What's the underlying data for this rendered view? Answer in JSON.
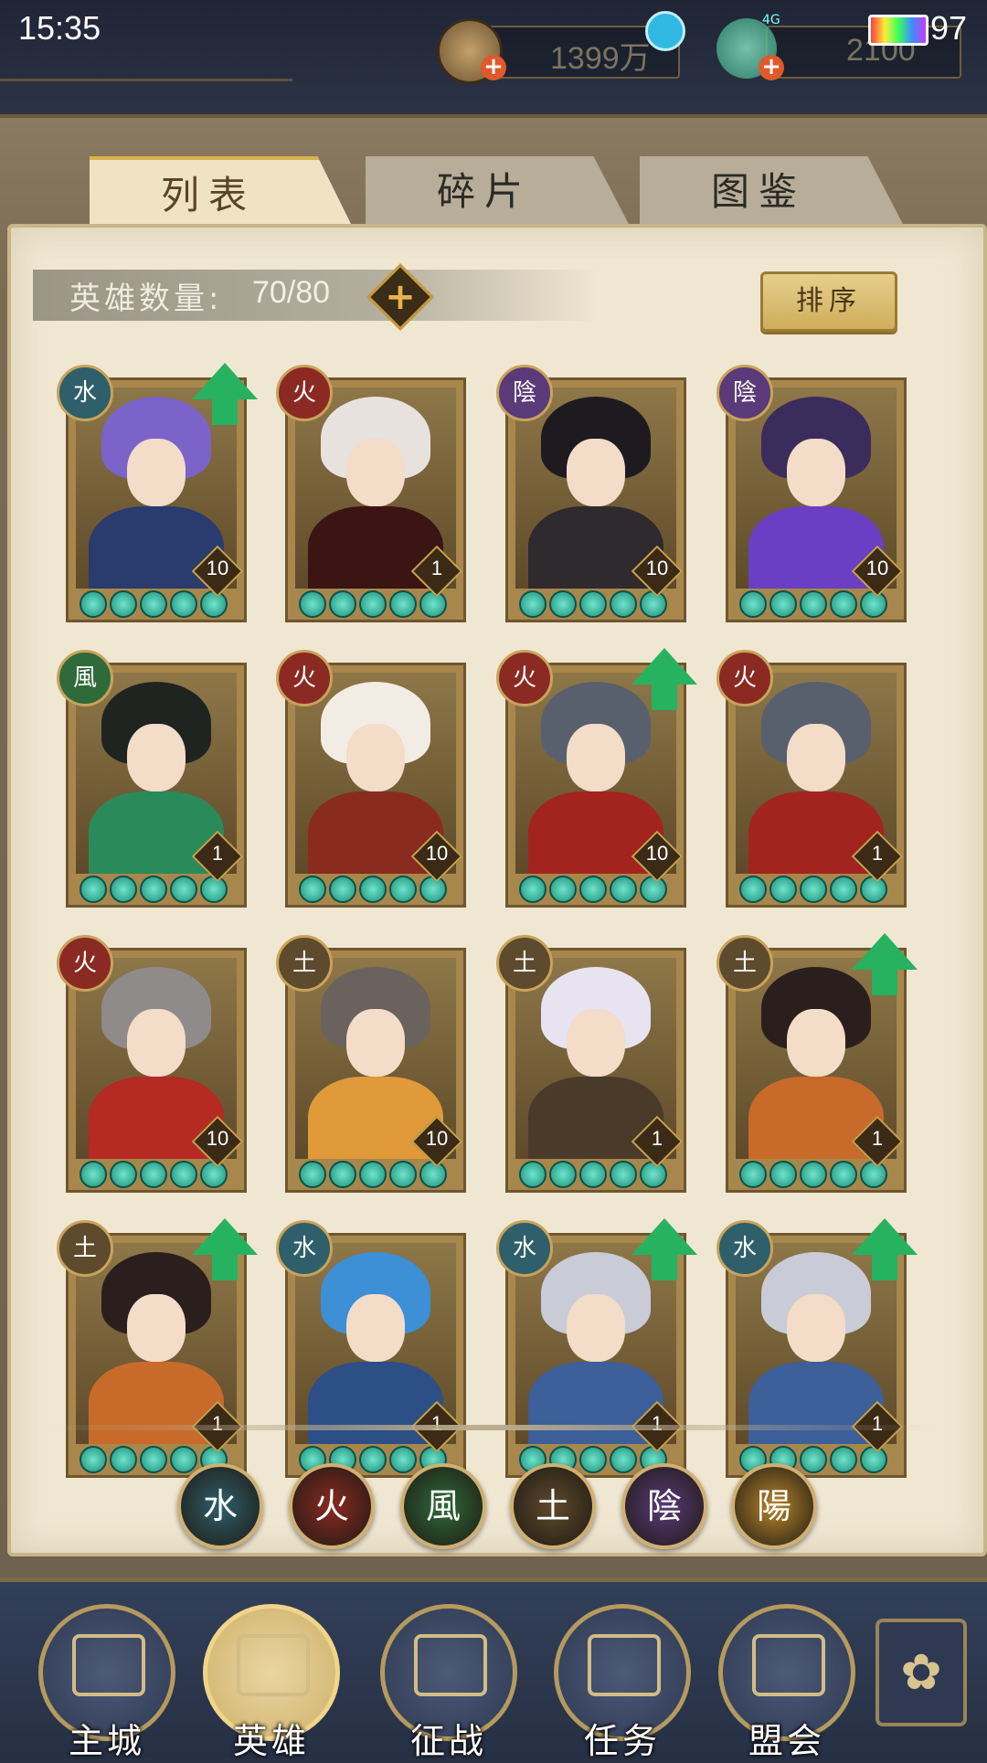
{
  "status_bar": {
    "time": "15:35",
    "battery": "97",
    "network": "4G"
  },
  "currency": {
    "coins": {
      "value": "1399万",
      "icon": "coin-icon"
    },
    "jade": {
      "value": "2100",
      "icon": "jade-icon"
    }
  },
  "tabs": [
    {
      "label": "列表",
      "active": true
    },
    {
      "label": "碎片",
      "active": false
    },
    {
      "label": "图鉴",
      "active": false
    }
  ],
  "hero_count": {
    "label": "英雄数量:",
    "value": "70/80"
  },
  "sort_button": "排序",
  "heroes": [
    {
      "element": "水",
      "element_color": "#2e5f6b",
      "level": "10",
      "stars": 5,
      "upgrade": true,
      "hair": "#7b63c9",
      "body": "#2a3b6d"
    },
    {
      "element": "火",
      "element_color": "#8a2a22",
      "level": "1",
      "stars": 5,
      "upgrade": false,
      "hair": "#e8e2de",
      "body": "#3b1414"
    },
    {
      "element": "陰",
      "element_color": "#5a3a78",
      "level": "10",
      "stars": 5,
      "upgrade": false,
      "hair": "#1e1b20",
      "body": "#2f2a2d"
    },
    {
      "element": "陰",
      "element_color": "#5a3a78",
      "level": "10",
      "stars": 5,
      "upgrade": false,
      "hair": "#3a2d5c",
      "body": "#6a3fc4"
    },
    {
      "element": "風",
      "element_color": "#2f6a3a",
      "level": "1",
      "stars": 5,
      "upgrade": false,
      "hair": "#1f2420",
      "body": "#2b8a5a"
    },
    {
      "element": "火",
      "element_color": "#8a2a22",
      "level": "10",
      "stars": 5,
      "upgrade": false,
      "hair": "#f3ece4",
      "body": "#8a2b1f"
    },
    {
      "element": "火",
      "element_color": "#8a2a22",
      "level": "10",
      "stars": 5,
      "upgrade": true,
      "hair": "#58606e",
      "body": "#a3241f"
    },
    {
      "element": "火",
      "element_color": "#8a2a22",
      "level": "1",
      "stars": 5,
      "upgrade": false,
      "hair": "#58606e",
      "body": "#a3241f"
    },
    {
      "element": "火",
      "element_color": "#8a2a22",
      "level": "10",
      "stars": 5,
      "upgrade": false,
      "hair": "#8f8b8a",
      "body": "#b52a22"
    },
    {
      "element": "土",
      "element_color": "#5e4a2c",
      "level": "10",
      "stars": 5,
      "upgrade": false,
      "hair": "#6b625d",
      "body": "#e09a3a"
    },
    {
      "element": "土",
      "element_color": "#5e4a2c",
      "level": "1",
      "stars": 5,
      "upgrade": false,
      "hair": "#e7e3f0",
      "body": "#4a3a2a"
    },
    {
      "element": "土",
      "element_color": "#5e4a2c",
      "level": "1",
      "stars": 5,
      "upgrade": true,
      "hair": "#2a1f1c",
      "body": "#c86b2a"
    },
    {
      "element": "土",
      "element_color": "#5e4a2c",
      "level": "1",
      "stars": 5,
      "upgrade": true,
      "hair": "#2a1f1c",
      "body": "#c86b2a"
    },
    {
      "element": "水",
      "element_color": "#2e5f6b",
      "level": "1",
      "stars": 5,
      "upgrade": false,
      "hair": "#3d8fd6",
      "body": "#2c4f86"
    },
    {
      "element": "水",
      "element_color": "#2e5f6b",
      "level": "1",
      "stars": 5,
      "upgrade": true,
      "hair": "#c9ccd6",
      "body": "#3d5f9a"
    },
    {
      "element": "水",
      "element_color": "#2e5f6b",
      "level": "1",
      "stars": 5,
      "upgrade": true,
      "hair": "#c9ccd6",
      "body": "#3d5f9a"
    }
  ],
  "element_filters": [
    {
      "glyph": "水",
      "color": "#2e5f6b"
    },
    {
      "glyph": "火",
      "color": "#8a2a22"
    },
    {
      "glyph": "風",
      "color": "#2f6a3a"
    },
    {
      "glyph": "土",
      "color": "#5e4a2c"
    },
    {
      "glyph": "陰",
      "color": "#5a3a78"
    },
    {
      "glyph": "陽",
      "color": "#b8862b"
    }
  ],
  "nav": [
    {
      "label": "主城",
      "icon": "castle-icon",
      "active": false
    },
    {
      "label": "英雄",
      "icon": "hero-portrait-icon",
      "active": true
    },
    {
      "label": "征战",
      "icon": "banner-icon",
      "active": false
    },
    {
      "label": "任务",
      "icon": "scroll-icon",
      "active": false
    },
    {
      "label": "盟会",
      "icon": "gate-icon",
      "active": false
    }
  ],
  "nav_more_icon": "flower-menu-icon"
}
